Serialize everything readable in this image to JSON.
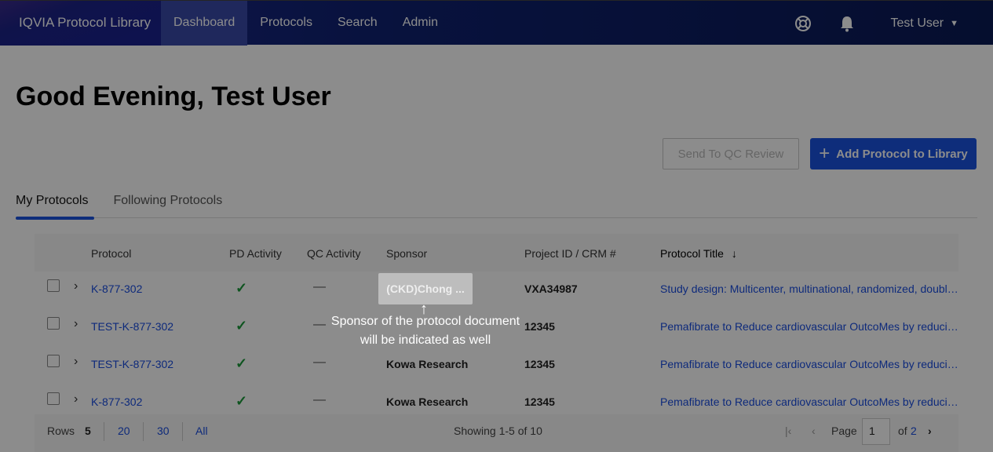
{
  "nav": {
    "brand": "IQVIA Protocol Library",
    "items": [
      "Dashboard",
      "Protocols",
      "Search",
      "Admin"
    ],
    "active": "Dashboard",
    "user": "Test User"
  },
  "greeting": "Good Evening, Test User",
  "actions": {
    "qc_review": "Send To QC Review",
    "add_protocol": "Add Protocol to Library"
  },
  "tabs": [
    "My Protocols",
    "Following Protocols"
  ],
  "table": {
    "columns": [
      "Protocol",
      "PD Activity",
      "QC Activity",
      "Sponsor",
      "Project ID / CRM #",
      "Protocol Title"
    ],
    "rows": [
      {
        "protocol": "K-877-302",
        "pd": "✓",
        "qc": "—",
        "sponsor": "",
        "project": "VXA34987",
        "title": "Study design: Multicenter, multinational, randomized, double..."
      },
      {
        "protocol": "TEST-K-877-302",
        "pd": "✓",
        "qc": "—",
        "sponsor": "",
        "project": "12345",
        "title": "Pemafibrate to Reduce cardiovascular OutcoMes by reducin..."
      },
      {
        "protocol": "TEST-K-877-302",
        "pd": "✓",
        "qc": "—",
        "sponsor": "Kowa Research",
        "project": "12345",
        "title": "Pemafibrate to Reduce cardiovascular OutcoMes by reducin..."
      },
      {
        "protocol": "K-877-302",
        "pd": "✓",
        "qc": "—",
        "sponsor": "Kowa Research",
        "project": "12345",
        "title": "Pemafibrate to Reduce cardiovascular OutcoMes by reducin..."
      }
    ]
  },
  "footer": {
    "rows_label": "Rows",
    "rows_options": [
      "5",
      "20",
      "30",
      "All"
    ],
    "showing": "Showing 1-5 of 10",
    "page_label": "Page",
    "page_value": "1",
    "of_label": "of",
    "total_pages": "2"
  },
  "tooltip": {
    "chip": "(CKD)Chong ...",
    "text": "Sponsor of the protocol document will be indicated as well"
  }
}
